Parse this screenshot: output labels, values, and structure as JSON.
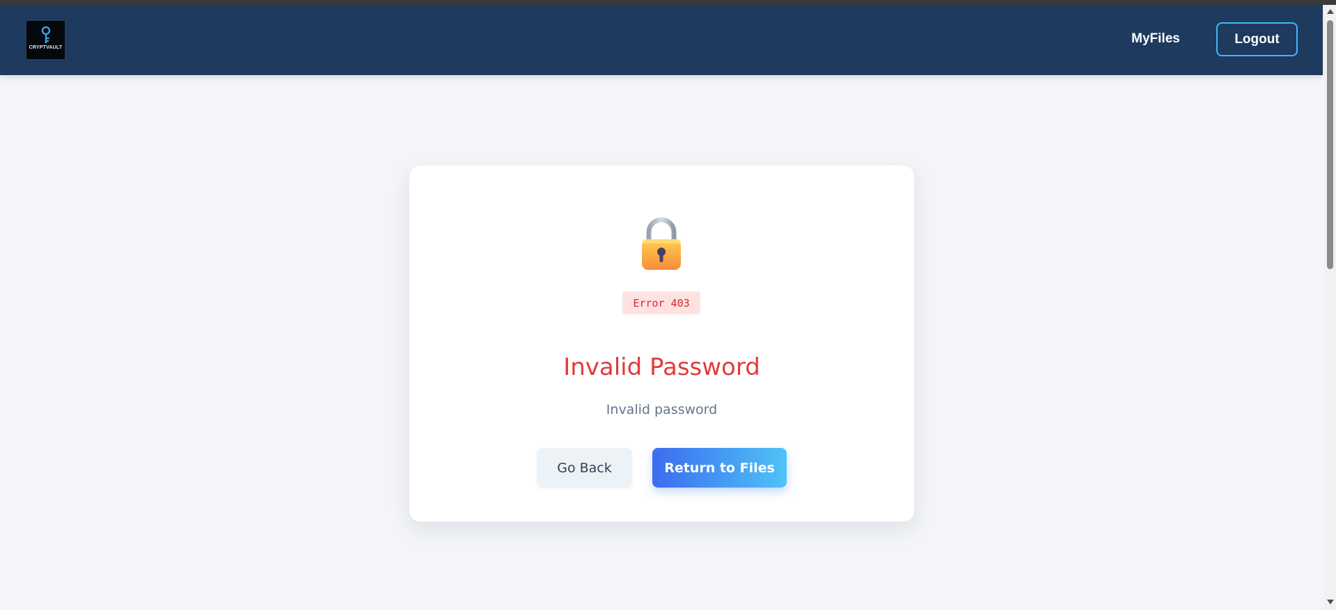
{
  "navbar": {
    "logo_text": "CRYPTVAULT",
    "links": [
      "MyFiles"
    ],
    "logout_label": "Logout"
  },
  "error": {
    "icon": "lock-icon",
    "code_label": "Error 403",
    "title": "Invalid Password",
    "message": "Invalid password"
  },
  "actions": {
    "back_label": "Go Back",
    "files_label": "Return to Files"
  },
  "colors": {
    "navbar_bg": "#1e3a5f",
    "accent": "#38bdf8",
    "error_red": "#e03b3b",
    "badge_bg": "#fee2e2",
    "primary_gradient_start": "#3b6cf0",
    "primary_gradient_end": "#4fc3f7"
  }
}
